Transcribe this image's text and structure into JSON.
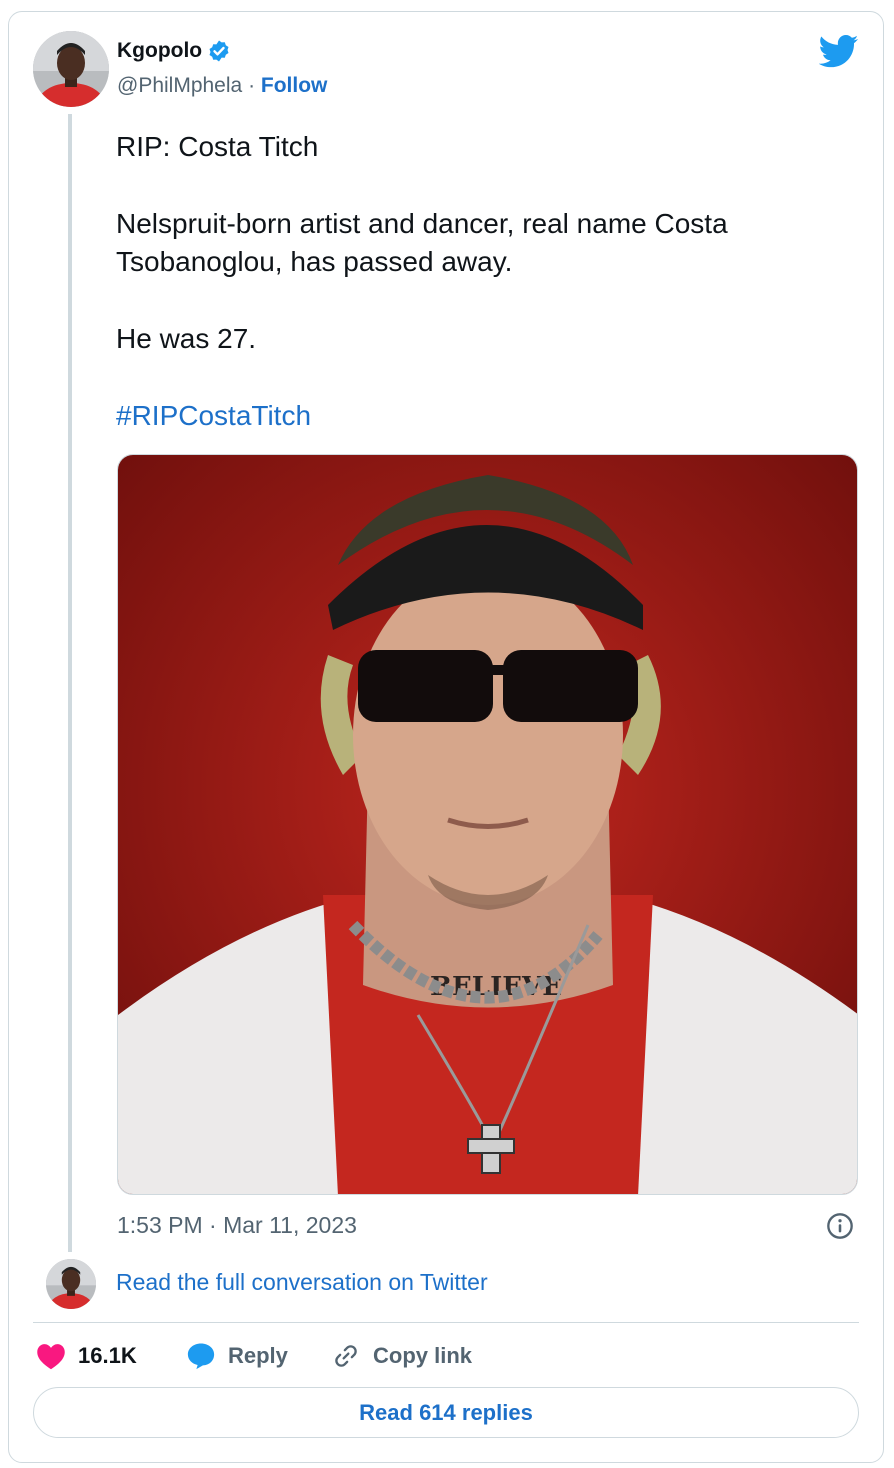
{
  "author": {
    "display_name": "Kgopolo",
    "handle": "@PhilMphela",
    "separator": "·",
    "follow_label": "Follow"
  },
  "tweet": {
    "lines": [
      "RIP: Costa Titch",
      "Nelspruit-born artist and dancer, real name Costa Tsobanoglou, has passed away.",
      "He was 27."
    ],
    "hashtag": "#RIPCostaTitch",
    "media_tattoo_text": "BELIEVE",
    "timestamp": "1:53 PM · Mar 11, 2023"
  },
  "conversation": {
    "link_label": "Read the full conversation on Twitter"
  },
  "actions": {
    "like_count": "16.1K",
    "reply_label": "Reply",
    "copy_label": "Copy link"
  },
  "footer": {
    "read_replies_label": "Read 614 replies"
  },
  "colors": {
    "accent": "#1d70c9",
    "twitter_blue": "#1d9bf0",
    "like_pink": "#f91880",
    "muted_text": "#536471",
    "border": "#cfd9de"
  },
  "icons": [
    "verified-badge-icon",
    "twitter-bird-icon",
    "info-icon",
    "heart-icon",
    "reply-bubble-icon",
    "link-icon"
  ]
}
